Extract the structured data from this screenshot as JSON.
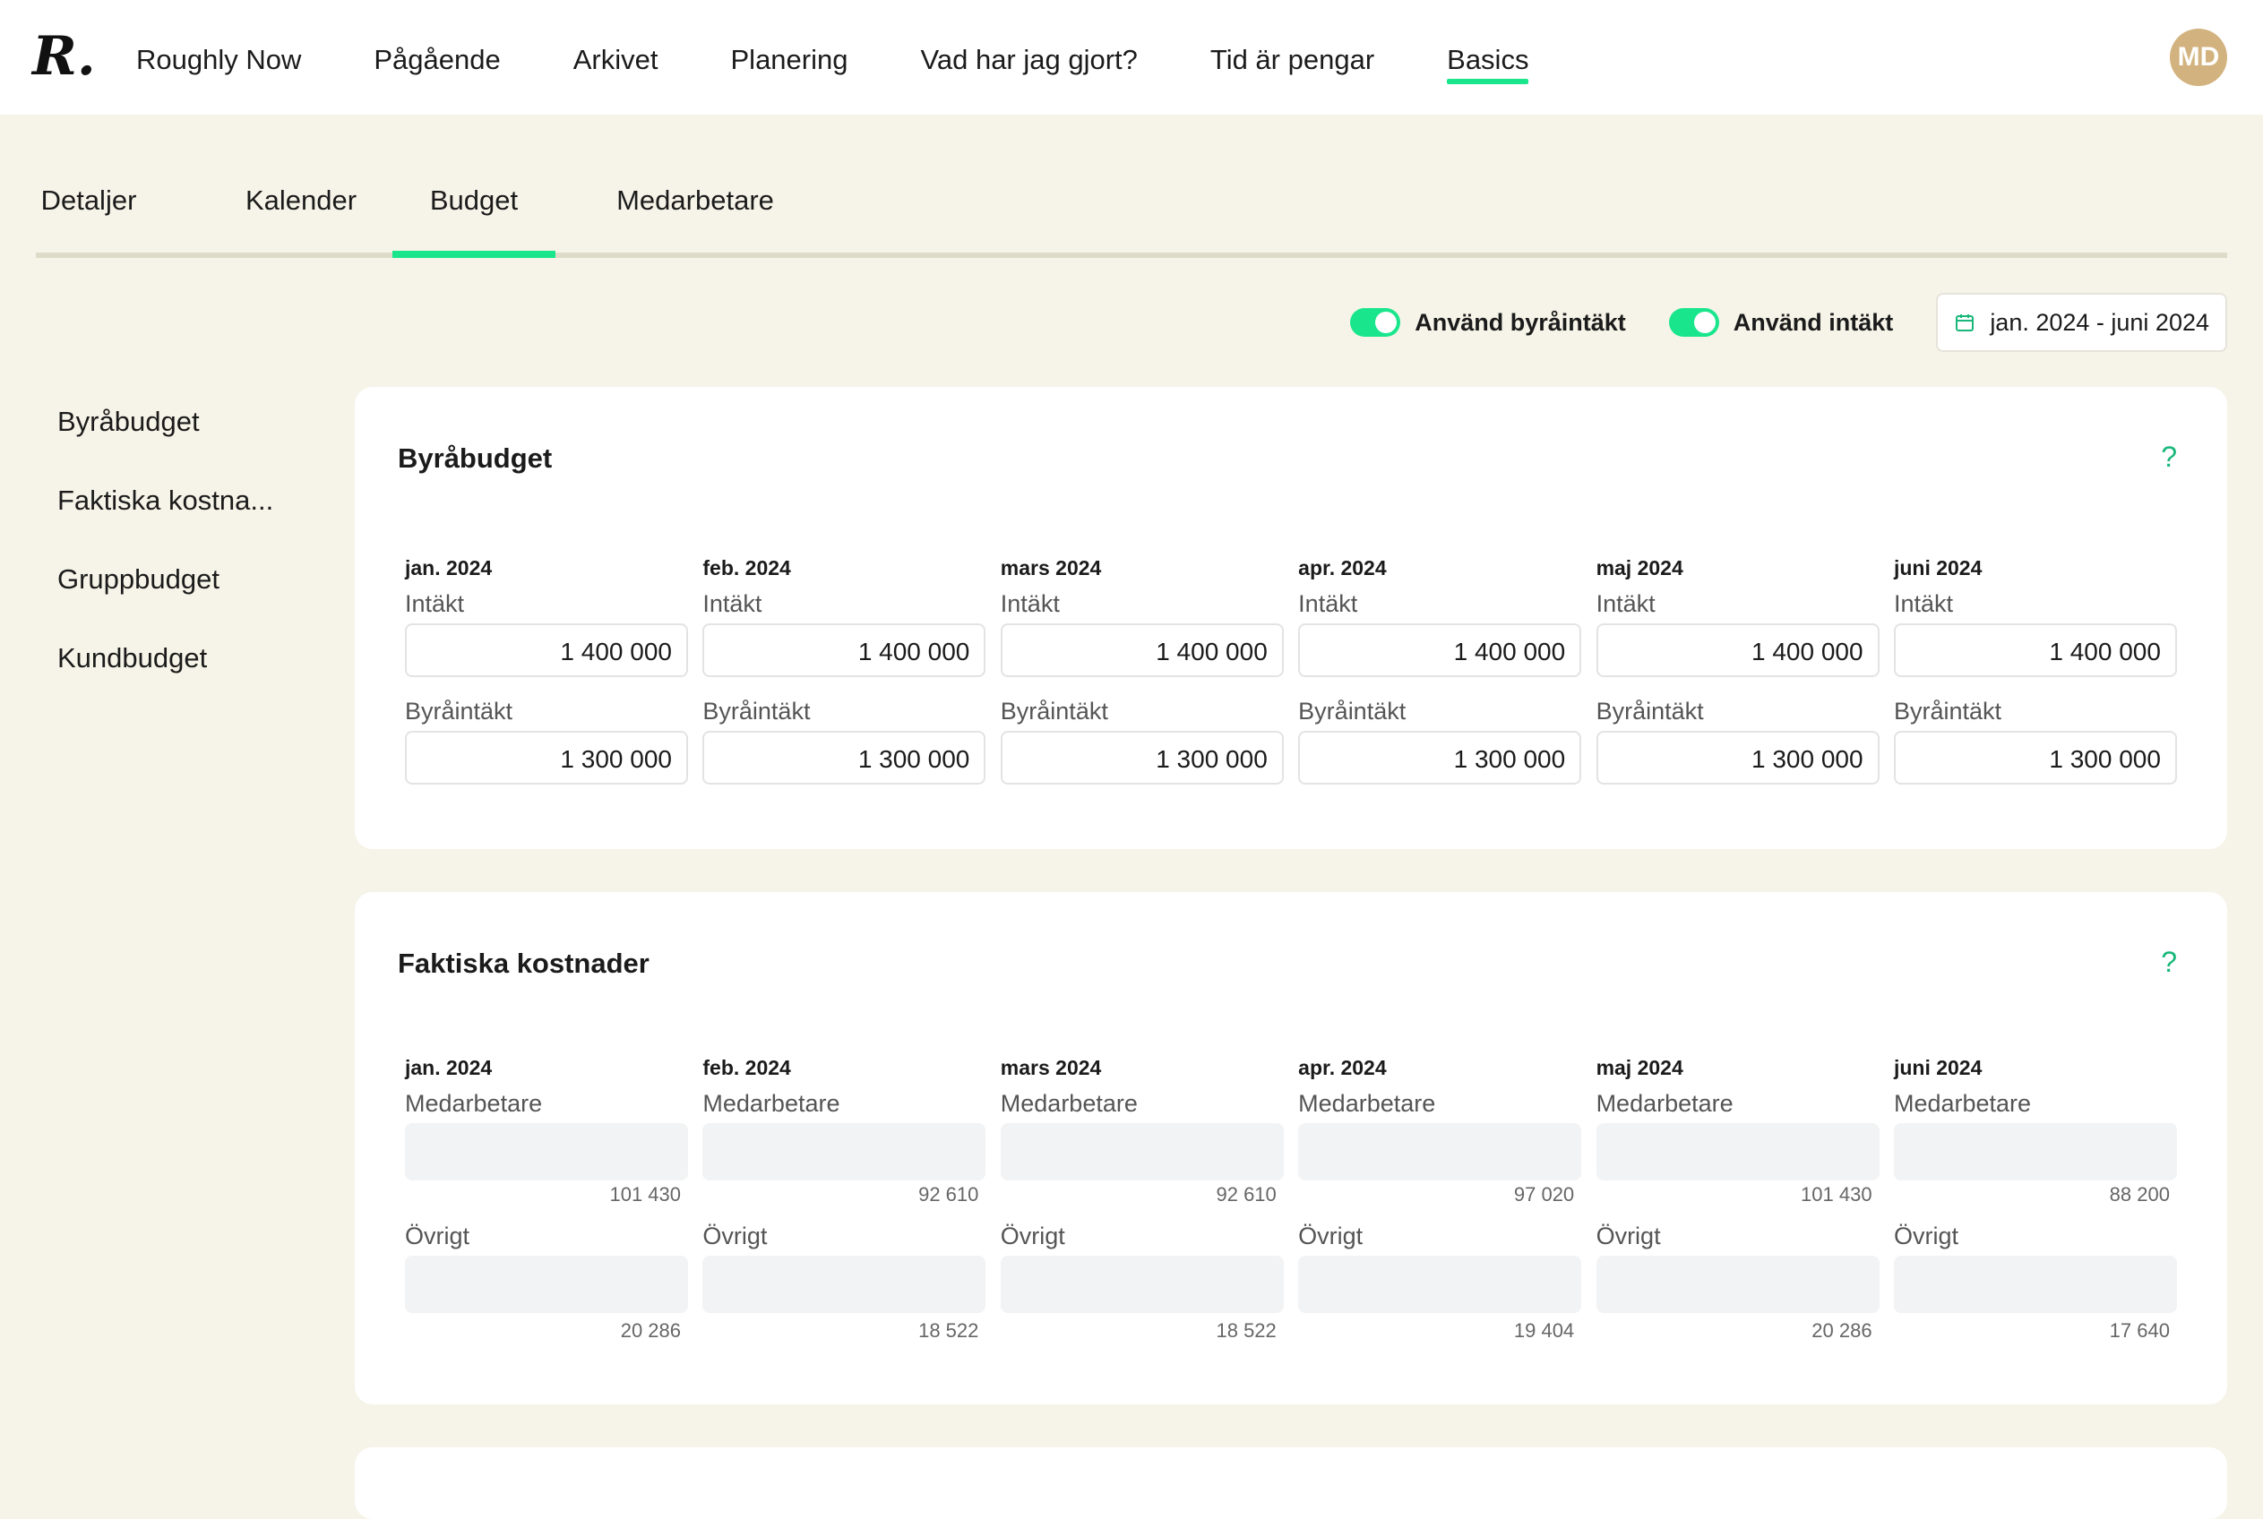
{
  "app": {
    "logo_text": "R.",
    "nav": [
      {
        "label": "Roughly Now",
        "active": false
      },
      {
        "label": "Pågående",
        "active": false
      },
      {
        "label": "Arkivet",
        "active": false
      },
      {
        "label": "Planering",
        "active": false
      },
      {
        "label": "Vad har jag gjort?",
        "active": false
      },
      {
        "label": "Tid är pengar",
        "active": false
      },
      {
        "label": "Basics",
        "active": true
      }
    ],
    "avatar": "MD",
    "accent_color": "#19e68c"
  },
  "subtabs": [
    {
      "label": "Detaljer",
      "active": false
    },
    {
      "label": "Kalender",
      "active": false
    },
    {
      "label": "Budget",
      "active": true
    },
    {
      "label": "Medarbetare",
      "active": false
    }
  ],
  "toolbar": {
    "toggle_agency_label": "Använd byråintäkt",
    "toggle_agency_on": true,
    "toggle_income_label": "Använd intäkt",
    "toggle_income_on": true,
    "date_range": "jan. 2024 - juni 2024",
    "date_icon": "calendar-icon"
  },
  "sidemenu": [
    "Byråbudget",
    "Faktiska kostna...",
    "Gruppbudget",
    "Kundbudget"
  ],
  "budget_card": {
    "title": "Byråbudget",
    "help": "?",
    "income_label": "Intäkt",
    "agency_income_label": "Byråintäkt",
    "months": [
      {
        "month": "jan. 2024",
        "income": "1 400 000",
        "agency_income": "1 300 000"
      },
      {
        "month": "feb. 2024",
        "income": "1 400 000",
        "agency_income": "1 300 000"
      },
      {
        "month": "mars 2024",
        "income": "1 400 000",
        "agency_income": "1 300 000"
      },
      {
        "month": "apr. 2024",
        "income": "1 400 000",
        "agency_income": "1 300 000"
      },
      {
        "month": "maj 2024",
        "income": "1 400 000",
        "agency_income": "1 300 000"
      },
      {
        "month": "juni 2024",
        "income": "1 400 000",
        "agency_income": "1 300 000"
      }
    ]
  },
  "costs_card": {
    "title": "Faktiska kostnader",
    "help": "?",
    "staff_label": "Medarbetare",
    "other_label": "Övrigt",
    "months": [
      {
        "month": "jan. 2024",
        "staff": "101 430",
        "other": "20 286"
      },
      {
        "month": "feb. 2024",
        "staff": "92 610",
        "other": "18 522"
      },
      {
        "month": "mars 2024",
        "staff": "92 610",
        "other": "18 522"
      },
      {
        "month": "apr. 2024",
        "staff": "97 020",
        "other": "19 404"
      },
      {
        "month": "maj 2024",
        "staff": "101 430",
        "other": "20 286"
      },
      {
        "month": "juni 2024",
        "staff": "88 200",
        "other": "17 640"
      }
    ]
  }
}
